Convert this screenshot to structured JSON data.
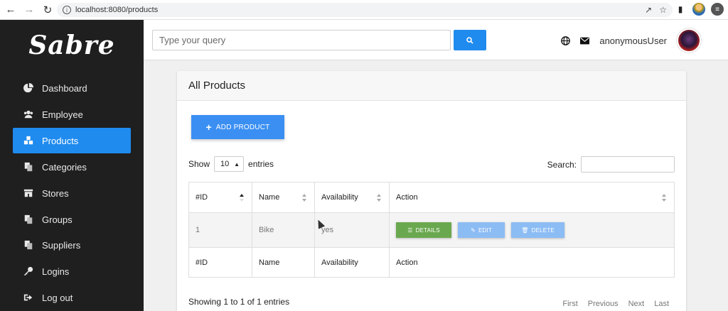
{
  "browser": {
    "url": "localhost:8080/products",
    "icons": [
      "back-arrow-icon",
      "forward-arrow-icon",
      "reload-icon",
      "info-icon",
      "share-icon",
      "star-icon",
      "sidepanel-icon",
      "profile-icon",
      "menu-icon"
    ]
  },
  "sidebar": {
    "logo": "Sabre",
    "items": [
      {
        "label": "Dashboard",
        "icon": "pie-chart-icon"
      },
      {
        "label": "Employee",
        "icon": "users-icon"
      },
      {
        "label": "Products",
        "icon": "boxes-icon",
        "active": true
      },
      {
        "label": "Categories",
        "icon": "copy-icon"
      },
      {
        "label": "Stores",
        "icon": "store-icon"
      },
      {
        "label": "Groups",
        "icon": "copy-icon"
      },
      {
        "label": "Suppliers",
        "icon": "copy-icon"
      },
      {
        "label": "Logins",
        "icon": "key-icon"
      },
      {
        "label": "Log out",
        "icon": "sign-out-icon"
      }
    ]
  },
  "header": {
    "search_placeholder": "Type your query",
    "username": "anonymousUser"
  },
  "main": {
    "card_title": "All Products",
    "add_button": "ADD PRODUCT",
    "show_label": "Show",
    "entries_value": "10",
    "entries_label": "entries",
    "search_label": "Search:",
    "columns": [
      "#ID",
      "Name",
      "Availability",
      "Action"
    ],
    "rows": [
      {
        "id": "1",
        "name": "Bike",
        "availability": "yes"
      }
    ],
    "actions": {
      "details": "DETAILS",
      "edit": "EDIT",
      "delete": "DELETE"
    },
    "footer_columns": [
      "#ID",
      "Name",
      "Availability",
      "Action"
    ],
    "info": "Showing 1 to 1 of 1 entries",
    "pager": {
      "first": "First",
      "previous": "Previous",
      "next": "Next",
      "last": "Last"
    }
  },
  "colors": {
    "sidebar_bg": "#1f1f1f",
    "accent": "#1f8bef",
    "details_green": "#6aa84f",
    "edit_blue": "#8cbcf4"
  }
}
